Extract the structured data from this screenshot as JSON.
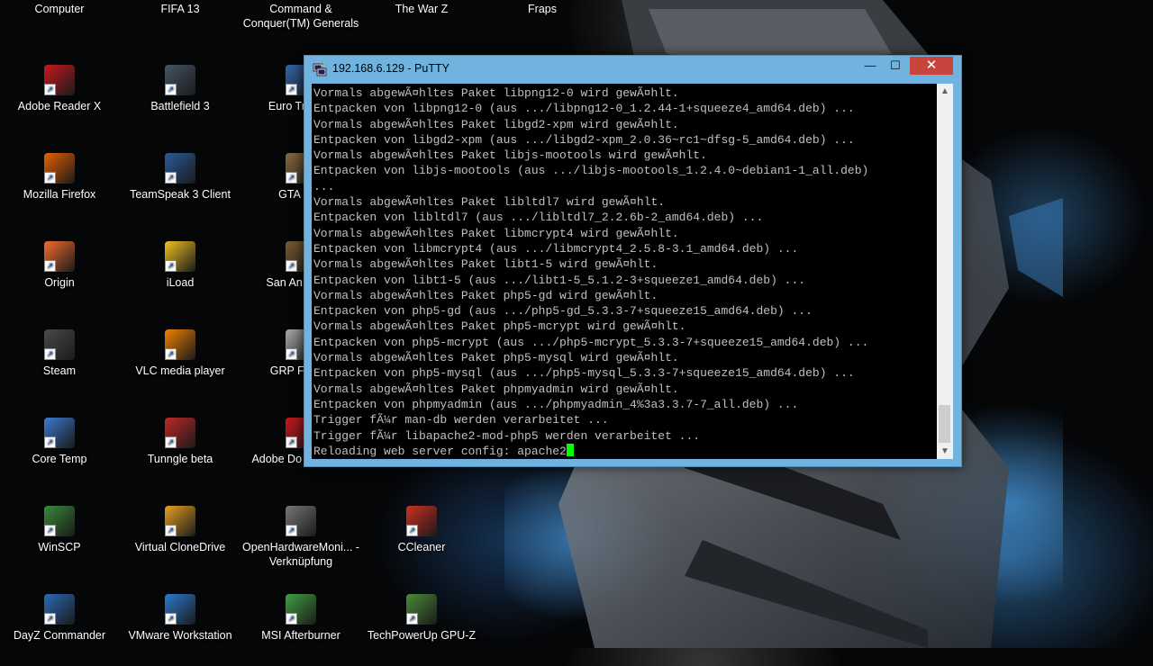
{
  "desktop": {
    "icons": [
      {
        "label": "Computer",
        "icon": "computer-icon",
        "color": "#3a78c8"
      },
      {
        "label": "FIFA 13",
        "icon": "fifa-icon",
        "color": "#2e6b3a"
      },
      {
        "label": "Command & Conquer(TM) Generals",
        "icon": "cnc-generals-icon",
        "color": "#6a5a3a"
      },
      {
        "label": "The War Z",
        "icon": "warz-icon",
        "color": "#555555"
      },
      {
        "label": "Fraps",
        "icon": "fraps-icon",
        "color": "#e0c020"
      },
      {
        "label": "Adobe Reader X",
        "icon": "adobe-reader-icon",
        "color": "#c8171e"
      },
      {
        "label": "Battlefield 3",
        "icon": "battlefield-icon",
        "color": "#445566"
      },
      {
        "label": "Euro Truck S",
        "icon": "euro-truck-icon",
        "color": "#3366aa"
      },
      {
        "label": "Mozilla Firefox",
        "icon": "firefox-icon",
        "color": "#e66000"
      },
      {
        "label": "TeamSpeak 3 Client",
        "icon": "teamspeak-icon",
        "color": "#2b5b9b"
      },
      {
        "label": "GTA San",
        "icon": "gta-icon",
        "color": "#8a6a40"
      },
      {
        "label": "Origin",
        "icon": "origin-icon",
        "color": "#f56c2d"
      },
      {
        "label": "iLoad",
        "icon": "iload-icon",
        "color": "#f0c020"
      },
      {
        "label": "San An Multip",
        "icon": "samp-icon",
        "color": "#7a5a30"
      },
      {
        "label": "Steam",
        "icon": "steam-icon",
        "color": "#4a4a4a"
      },
      {
        "label": "VLC media player",
        "icon": "vlc-icon",
        "color": "#f08000"
      },
      {
        "label": "GRP Fairpla",
        "icon": "grp-icon",
        "color": "#aaaaaa"
      },
      {
        "label": "Core Temp",
        "icon": "core-temp-icon",
        "color": "#3a7ad0"
      },
      {
        "label": "Tunngle beta",
        "icon": "tunngle-icon",
        "color": "#c02828"
      },
      {
        "label": "Adobe Do Assistant",
        "icon": "adobe-dl-icon",
        "color": "#c8171e"
      },
      {
        "label": "Verknüpfung",
        "icon": "shortcut-icon",
        "color": "#666666"
      },
      {
        "label": "WinSCP",
        "icon": "winscp-icon",
        "color": "#3a8a3a"
      },
      {
        "label": "Virtual CloneDrive",
        "icon": "clonedrive-icon",
        "color": "#e8a020"
      },
      {
        "label": "OpenHardwareMoni... - Verknüpfung",
        "icon": "openhardwaremonitor-icon",
        "color": "#777777"
      },
      {
        "label": "CCleaner",
        "icon": "ccleaner-icon",
        "color": "#d03020"
      },
      {
        "label": "DayZ Commander",
        "icon": "dayz-icon",
        "color": "#2a6ab8"
      },
      {
        "label": "VMware Workstation",
        "icon": "vmware-icon",
        "color": "#2a7ad0"
      },
      {
        "label": "MSI Afterburner",
        "icon": "msi-afterburner-icon",
        "color": "#40a040"
      },
      {
        "label": "TechPowerUp GPU-Z",
        "icon": "gpuz-icon",
        "color": "#4a8a3a"
      }
    ]
  },
  "putty": {
    "title": "192.168.6.129 - PuTTY",
    "minimize": "—",
    "maximize": "☐",
    "close": "✕",
    "lines": [
      "Vormals abgewÃ¤hltes Paket libpng12-0 wird gewÃ¤hlt.",
      "Entpacken von libpng12-0 (aus .../libpng12-0_1.2.44-1+squeeze4_amd64.deb) ...",
      "Vormals abgewÃ¤hltes Paket libgd2-xpm wird gewÃ¤hlt.",
      "Entpacken von libgd2-xpm (aus .../libgd2-xpm_2.0.36~rc1~dfsg-5_amd64.deb) ...",
      "Vormals abgewÃ¤hltes Paket libjs-mootools wird gewÃ¤hlt.",
      "Entpacken von libjs-mootools (aus .../libjs-mootools_1.2.4.0~debian1-1_all.deb)",
      "...",
      "Vormals abgewÃ¤hltes Paket libltdl7 wird gewÃ¤hlt.",
      "Entpacken von libltdl7 (aus .../libltdl7_2.2.6b-2_amd64.deb) ...",
      "Vormals abgewÃ¤hltes Paket libmcrypt4 wird gewÃ¤hlt.",
      "Entpacken von libmcrypt4 (aus .../libmcrypt4_2.5.8-3.1_amd64.deb) ...",
      "Vormals abgewÃ¤hltes Paket libt1-5 wird gewÃ¤hlt.",
      "Entpacken von libt1-5 (aus .../libt1-5_5.1.2-3+squeeze1_amd64.deb) ...",
      "Vormals abgewÃ¤hltes Paket php5-gd wird gewÃ¤hlt.",
      "Entpacken von php5-gd (aus .../php5-gd_5.3.3-7+squeeze15_amd64.deb) ...",
      "Vormals abgewÃ¤hltes Paket php5-mcrypt wird gewÃ¤hlt.",
      "Entpacken von php5-mcrypt (aus .../php5-mcrypt_5.3.3-7+squeeze15_amd64.deb) ...",
      "Vormals abgewÃ¤hltes Paket php5-mysql wird gewÃ¤hlt.",
      "Entpacken von php5-mysql (aus .../php5-mysql_5.3.3-7+squeeze15_amd64.deb) ...",
      "Vormals abgewÃ¤hltes Paket phpmyadmin wird gewÃ¤hlt.",
      "Entpacken von phpmyadmin (aus .../phpmyadmin_4%3a3.3.7-7_all.deb) ...",
      "Trigger fÃ¼r man-db werden verarbeitet ...",
      "Trigger fÃ¼r libapache2-mod-php5 werden verarbeitet ...",
      "Reloading web server config: apache2"
    ],
    "cursor_color": "#00ff00",
    "text_color": "#c0c0c0"
  }
}
